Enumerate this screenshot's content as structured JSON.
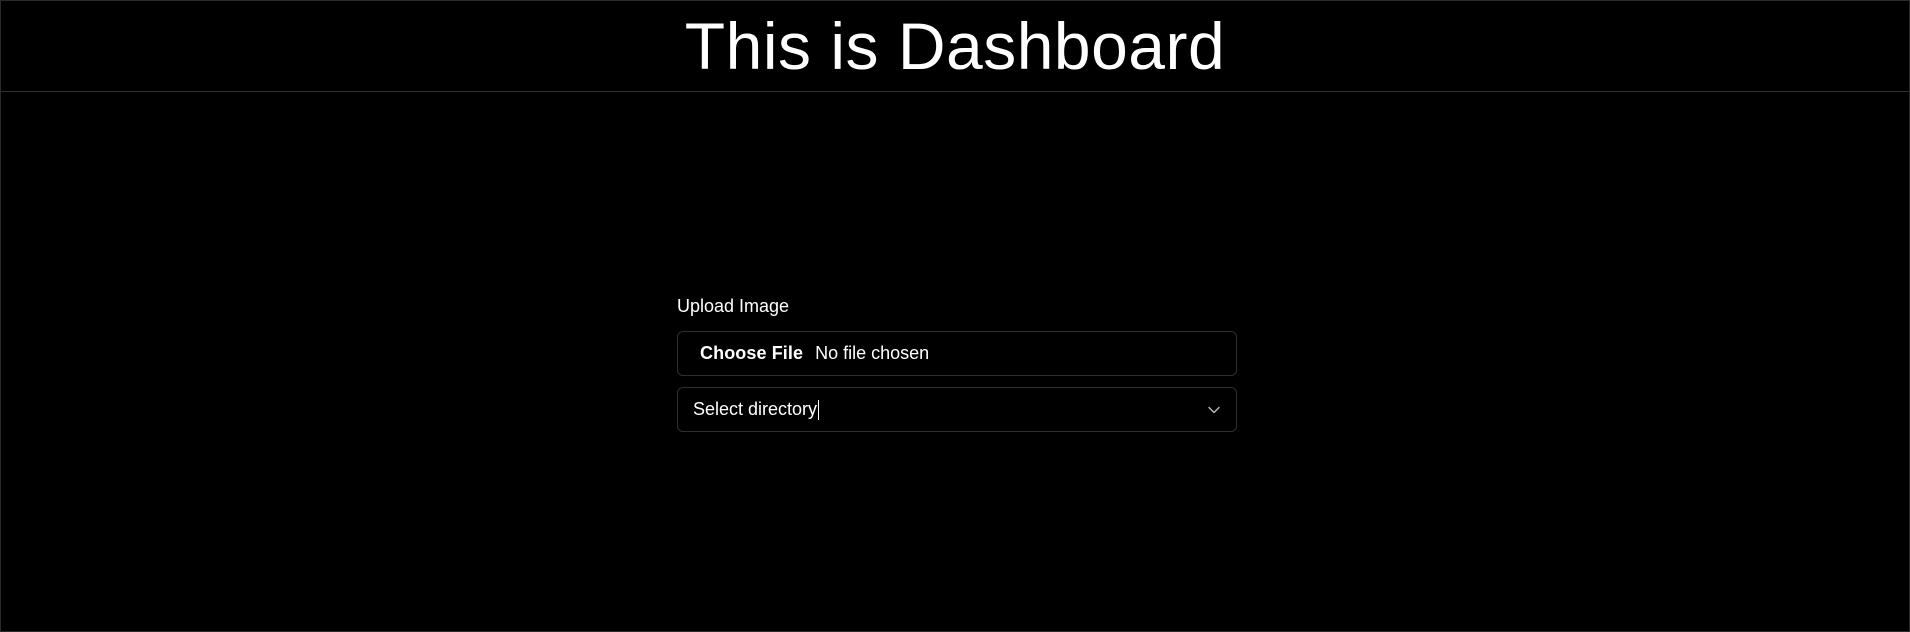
{
  "header": {
    "title": "This is Dashboard"
  },
  "upload": {
    "label": "Upload Image",
    "file_button_label": "Choose File",
    "file_status": "No file chosen"
  },
  "directory_select": {
    "selected_value": "Select directory",
    "icon": "chevron-down-icon"
  },
  "colors": {
    "background": "#000000",
    "text": "#ffffff",
    "border": "#2f2f2f"
  }
}
